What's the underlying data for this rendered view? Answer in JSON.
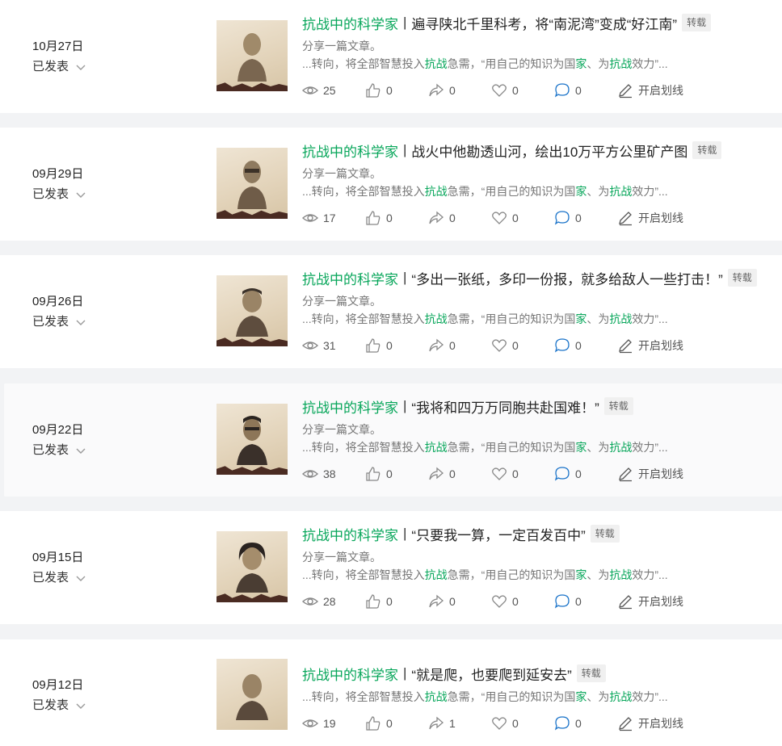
{
  "brand_label": "抗战中的科学家",
  "separator": "|",
  "tag_label": "转载",
  "desc_text": "分享一篇文章。",
  "excerpt": {
    "p1": "...转向，将全部智慧投入",
    "h1": "抗战",
    "p2": "急需，“用自己的知识为国",
    "h2": "家",
    "p3": "、为",
    "h3": "抗战",
    "p4": "效力”..."
  },
  "highlight_label": "开启划线",
  "colors": {
    "brand_green": "#07a65a",
    "text": "#333333",
    "muted": "#777777",
    "card_bg": "#ffffff",
    "page_bg": "#f2f3f5"
  },
  "icons": [
    "eye-icon",
    "thumbs-up-icon",
    "share-icon",
    "heart-icon",
    "comment-icon",
    "pen-icon",
    "chevron-down-icon"
  ],
  "articles": [
    {
      "date": "10月27日",
      "status": "已发表",
      "title": "遍寻陕北千里科考，将“南泥湾”变成“好江南”",
      "views": "25",
      "likes": "0",
      "shares": "0",
      "favs": "0",
      "comments": "0"
    },
    {
      "date": "09月29日",
      "status": "已发表",
      "title": "战火中他勘透山河，绘出10万平方公里矿产图",
      "views": "17",
      "likes": "0",
      "shares": "0",
      "favs": "0",
      "comments": "0"
    },
    {
      "date": "09月26日",
      "status": "已发表",
      "title": "“多出一张纸，多印一份报，就多给敌人一些打击！”",
      "views": "31",
      "likes": "0",
      "shares": "0",
      "favs": "0",
      "comments": "0"
    },
    {
      "date": "09月22日",
      "status": "已发表",
      "title": "“我将和四万万同胞共赴国难！”",
      "views": "38",
      "likes": "0",
      "shares": "0",
      "favs": "0",
      "comments": "0"
    },
    {
      "date": "09月15日",
      "status": "已发表",
      "title": "“只要我一算，一定百发百中”",
      "views": "28",
      "likes": "0",
      "shares": "0",
      "favs": "0",
      "comments": "0"
    },
    {
      "date": "09月12日",
      "status": "已发表",
      "title": "“就是爬，也要爬到延安去”",
      "views": "19",
      "likes": "0",
      "shares": "1",
      "favs": "0",
      "comments": "0"
    }
  ]
}
